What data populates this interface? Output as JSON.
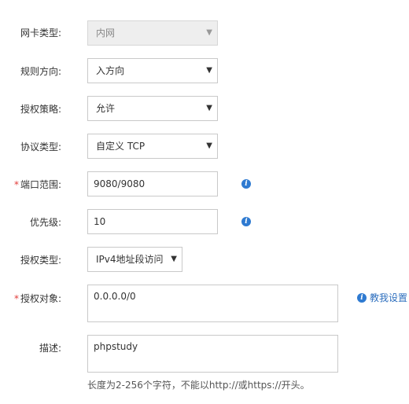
{
  "form": {
    "nic_type": {
      "label": "网卡类型:",
      "value": "内网"
    },
    "rule_direction": {
      "label": "规则方向:",
      "value": "入方向"
    },
    "auth_policy": {
      "label": "授权策略:",
      "value": "允许"
    },
    "protocol_type": {
      "label": "协议类型:",
      "value": "自定义 TCP"
    },
    "port_range": {
      "required_mark": "*",
      "label": "端口范围:",
      "value": "9080/9080"
    },
    "priority": {
      "label": "优先级:",
      "value": "10"
    },
    "auth_type": {
      "label": "授权类型:",
      "value": "IPv4地址段访问"
    },
    "auth_object": {
      "required_mark": "*",
      "label": "授权对象:",
      "value": "0.0.0.0/0",
      "help_link": "教我设置"
    },
    "description": {
      "label": "描述:",
      "value": "phpstudy",
      "hint": "长度为2-256个字符，不能以http://或https://开头。"
    }
  },
  "icons": {
    "dropdown": "chevron-down-icon",
    "info": "info-icon"
  },
  "colors": {
    "accent": "#2e7ad1",
    "required": "#e23c39",
    "link": "#2e6fbe",
    "disabled_bg": "#eeeeee"
  }
}
